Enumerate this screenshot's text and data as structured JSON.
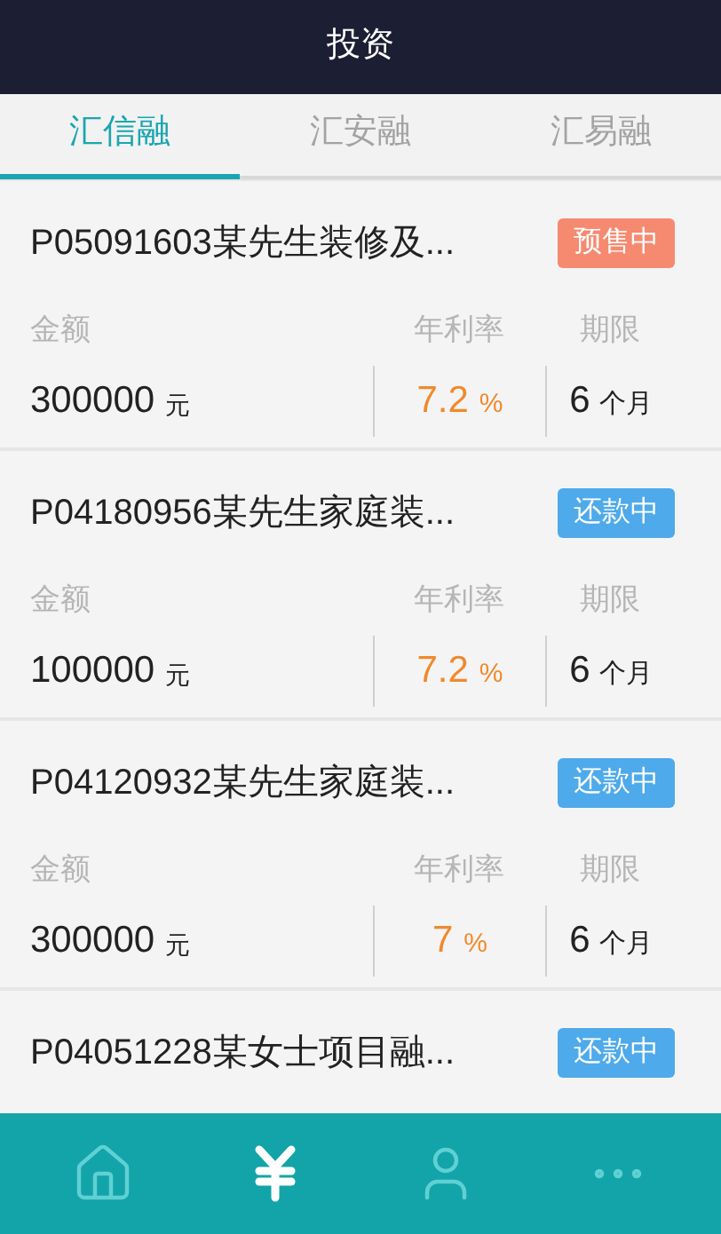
{
  "header": {
    "title": "投资"
  },
  "tabs": [
    {
      "label": "汇信融",
      "selected": true
    },
    {
      "label": "汇安融",
      "selected": false
    },
    {
      "label": "汇易融",
      "selected": false
    }
  ],
  "loans": [
    {
      "title": "P05091603某先生装修及...",
      "status": {
        "text": "预售中",
        "color": "#f58a70"
      },
      "labels": {
        "amount": "金额",
        "rate": "年利率",
        "term": "期限"
      },
      "amount": "300000",
      "amount_unit": "元",
      "rate": "7.2",
      "rate_unit": "%",
      "term": "6",
      "term_unit": "个月"
    },
    {
      "title": "P04180956某先生家庭装...",
      "status": {
        "text": "还款中",
        "color": "#4eaaea"
      },
      "labels": {
        "amount": "金额",
        "rate": "年利率",
        "term": "期限"
      },
      "amount": "100000",
      "amount_unit": "元",
      "rate": "7.2",
      "rate_unit": "%",
      "term": "6",
      "term_unit": "个月"
    },
    {
      "title": "P04120932某先生家庭装...",
      "status": {
        "text": "还款中",
        "color": "#4eaaea"
      },
      "labels": {
        "amount": "金额",
        "rate": "年利率",
        "term": "期限"
      },
      "amount": "300000",
      "amount_unit": "元",
      "rate": "7",
      "rate_unit": "%",
      "term": "6",
      "term_unit": "个月"
    },
    {
      "title": "P04051228某女士项目融...",
      "status": {
        "text": "还款中",
        "color": "#4eaaea"
      }
    }
  ],
  "nav": [
    {
      "kind": "home",
      "selected": false
    },
    {
      "kind": "yen",
      "selected": true
    },
    {
      "kind": "user",
      "selected": false
    },
    {
      "kind": "more",
      "selected": false
    }
  ]
}
